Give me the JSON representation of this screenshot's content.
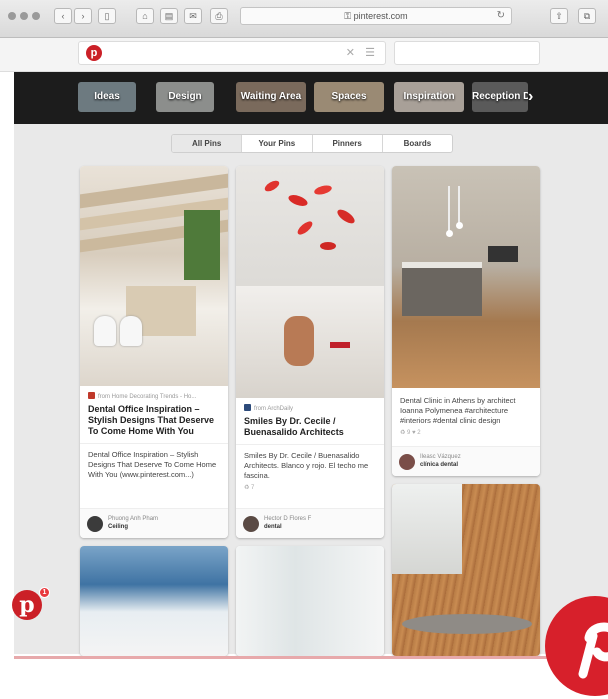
{
  "browser": {
    "url": "pinterest.com",
    "url_prefix": "⚿ "
  },
  "pinterest": {
    "logo": "p"
  },
  "categories": [
    {
      "label": "Ideas",
      "color": "#6d7a80"
    },
    {
      "label": "Design",
      "color": "#8c8e8c"
    },
    {
      "label": "Waiting Area",
      "color": "#7a6a5c"
    },
    {
      "label": "Spaces",
      "color": "#9a8a74"
    },
    {
      "label": "Inspiration",
      "color": "#a8a098"
    },
    {
      "label": "Reception Desks",
      "color": "#5a5a5a"
    }
  ],
  "tabs": [
    "All Pins",
    "Your Pins",
    "Pinners",
    "Boards"
  ],
  "pins": [
    {
      "source": "from Home Decorating Trends - Ho...",
      "title": "Dental Office Inspiration – Stylish Designs That Deserve To Come Home With You",
      "desc": "Dental Office Inspiration – Stylish Designs That Deserve To Come Home With You (www.pinterest.com...)",
      "stats": "",
      "user": "Phuong Anh Pham",
      "board": "Ceiling"
    },
    {
      "source": "from ArchDaily",
      "title": "Smiles By Dr. Cecile / Buenasalido Architects",
      "desc": "Smiles By Dr. Cecile / Buenasalido Architects. Blanco y rojo. El techo me fascina.",
      "stats": "♻ 7",
      "user": "Hector D Flores F",
      "board": "dental"
    },
    {
      "source": "",
      "title": "",
      "desc": "Dental Clinic in Athens by architect Ioanna Polymenea #architecture #interiors #dental clinic design",
      "stats": "♻ 9 ♥ 2",
      "user": "Ileasc Vázquez",
      "board": "clínica dental"
    }
  ],
  "notif": {
    "count": "1"
  },
  "colors": {
    "brand": "#cb2027",
    "catbar": "#1c1c1c"
  }
}
